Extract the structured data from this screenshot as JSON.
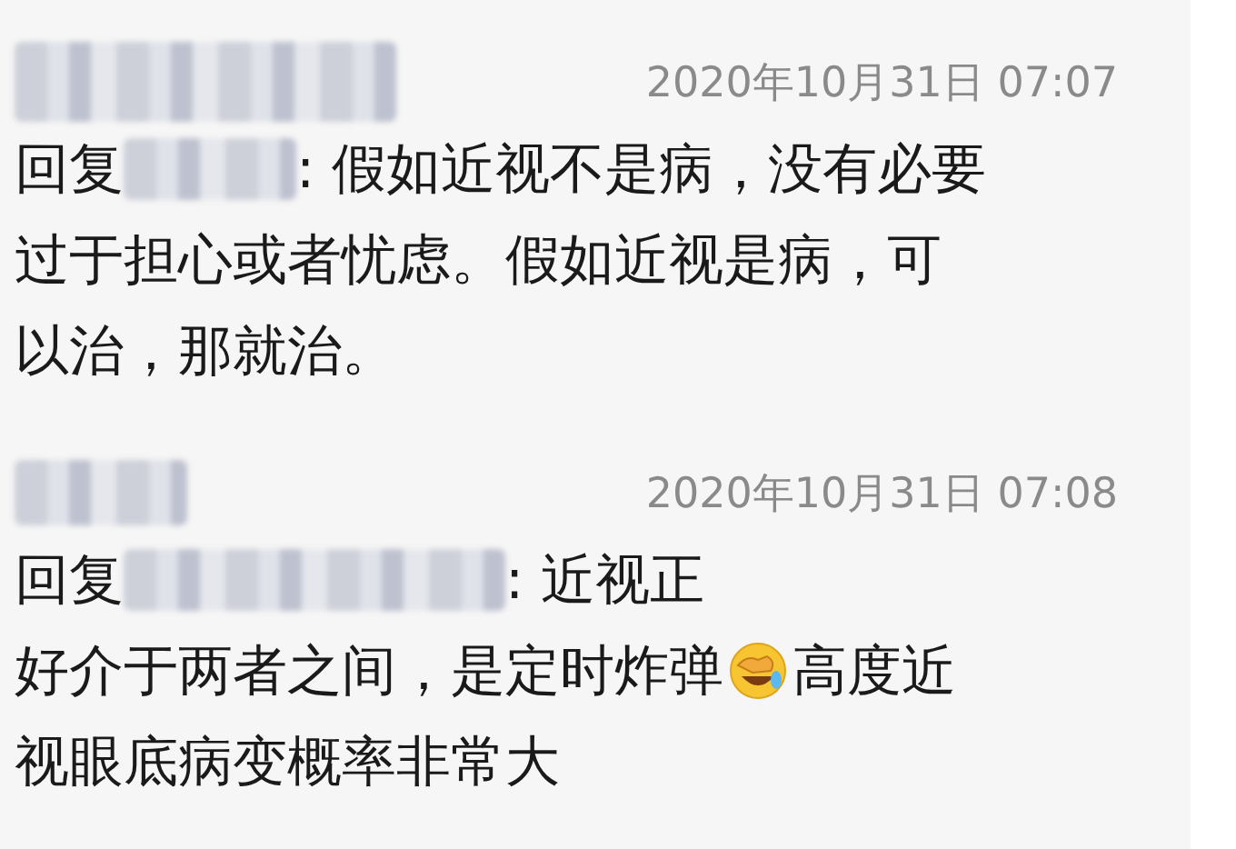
{
  "comments": [
    {
      "author": {
        "kind": "longblur"
      },
      "time": "2020年10月31日 07:07",
      "lines": [
        [
          {
            "kind": "text",
            "text": "回复"
          },
          {
            "kind": "shortblur"
          },
          {
            "kind": "text",
            "text": ": 假如近视不是病，没有必要"
          }
        ],
        [
          {
            "kind": "text",
            "text": "过于担心或者忧虑。假如近视是病，可"
          }
        ],
        [
          {
            "kind": "text",
            "text": "以治，那就治。"
          }
        ]
      ]
    },
    {
      "author": {
        "kind": "shortblur"
      },
      "time": "2020年10月31日 07:08",
      "lines": [
        [
          {
            "kind": "text",
            "text": "回复"
          },
          {
            "kind": "longblur"
          },
          {
            "kind": "text",
            "text": ": 近视正"
          }
        ],
        [
          {
            "kind": "text",
            "text": "好介于两者之间，是定时炸弹"
          },
          {
            "kind": "emoji"
          },
          {
            "kind": "text",
            "text": "高度近"
          }
        ],
        [
          {
            "kind": "text",
            "text": "视眼底病变概率非常大"
          }
        ]
      ]
    }
  ]
}
